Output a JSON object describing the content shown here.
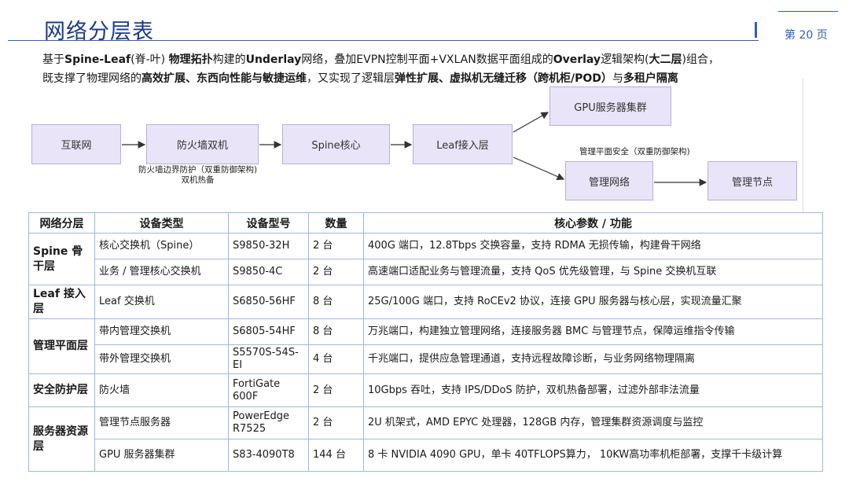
{
  "header": {
    "title": "网络分层表",
    "page_number": "第 20 页"
  },
  "intro": {
    "line1": [
      {
        "text": "基于",
        "bold": false
      },
      {
        "text": "Spine-Leaf",
        "bold": true
      },
      {
        "text": "(脊-叶) ",
        "bold": false
      },
      {
        "text": "物理拓扑",
        "bold": true
      },
      {
        "text": "构建的",
        "bold": false
      },
      {
        "text": "Underlay",
        "bold": true
      },
      {
        "text": "网络，叠加EVPN控制平面+VXLAN数据平面组成的",
        "bold": false
      },
      {
        "text": "Overlay",
        "bold": true
      },
      {
        "text": "逻辑架构(",
        "bold": false
      },
      {
        "text": "大二层",
        "bold": true
      },
      {
        "text": ")组合，",
        "bold": false
      }
    ],
    "line2": [
      {
        "text": "既支撑了物理网络的",
        "bold": false
      },
      {
        "text": "高效扩展、东西向性能与敏捷运维",
        "bold": true
      },
      {
        "text": "，又实现了逻辑层",
        "bold": false
      },
      {
        "text": "弹性扩展、虚拟机无缝迁移（跨机柜/POD）",
        "bold": true
      },
      {
        "text": "与",
        "bold": false
      },
      {
        "text": "多租户隔离",
        "bold": true
      }
    ]
  },
  "flow": {
    "nodes": {
      "internet": "互联网",
      "firewall": "防火墙双机",
      "spine": "Spine核心",
      "leaf": "Leaf接入层",
      "gpu": "GPU服务器集群",
      "mgmt_net": "管理网络",
      "mgmt_node": "管理节点"
    },
    "labels": {
      "firewall_line1": "防火墙边界防护（双重防御架构)",
      "firewall_line2": "双机热备",
      "mgmt_security": "管理平面安全（双重防御架构)"
    }
  },
  "table": {
    "headers": [
      "网络分层",
      "设备类型",
      "设备型号",
      "数量",
      "核心参数 / 功能"
    ],
    "groups": [
      {
        "layer": "Spine 骨干层",
        "rows": [
          {
            "type": "核心交换机（Spine）",
            "model": "S9850-32H",
            "qty": "2 台",
            "spec": "400G 端口，12.8Tbps 交换容量，支持 RDMA 无损传输，构建骨干网络"
          },
          {
            "type": "业务 / 管理核心交换机",
            "model": "S9850-4C",
            "qty": "2 台",
            "spec": "高速端口适配业务与管理流量，支持 QoS 优先级管理，与 Spine 交换机互联"
          }
        ]
      },
      {
        "layer": "Leaf 接入层",
        "rows": [
          {
            "type": "Leaf 交换机",
            "model": "S6850-56HF",
            "qty": "8 台",
            "spec": "25G/100G 端口，支持 RoCEv2 协议，连接 GPU 服务器与核心层，实现流量汇聚"
          }
        ]
      },
      {
        "layer": "管理平面层",
        "rows": [
          {
            "type": "带内管理交换机",
            "model": "S6805-54HF",
            "qty": "8 台",
            "spec": "万兆端口，构建独立管理网络，连接服务器 BMC 与管理节点，保障运维指令传输"
          },
          {
            "type": "带外管理交换机",
            "model": "S5570S-54S-EI",
            "qty": "4 台",
            "spec": "千兆端口，提供应急管理通道，支持远程故障诊断，与业务网络物理隔离"
          }
        ]
      },
      {
        "layer": "安全防护层",
        "rows": [
          {
            "type": "防火墙",
            "model": "FortiGate 600F",
            "qty": "2 台",
            "spec": "10Gbps 吞吐，支持 IPS/DDoS 防护，双机热备部署，过滤外部非法流量"
          }
        ]
      },
      {
        "layer": "服务器资源层",
        "rows": [
          {
            "type": "管理节点服务器",
            "model": "PowerEdge R7525",
            "qty": "2 台",
            "spec": "2U 机架式，AMD EPYC 处理器，128GB 内存，管理集群资源调度与监控"
          },
          {
            "type": "GPU 服务器集群",
            "model": "S83-4090T8",
            "qty": "144 台",
            "spec": "8 卡 NVIDIA 4090 GPU，单卡 40TFLOPS算力， 10KW高功率机柜部署，支撑千卡级计算"
          }
        ]
      }
    ]
  }
}
